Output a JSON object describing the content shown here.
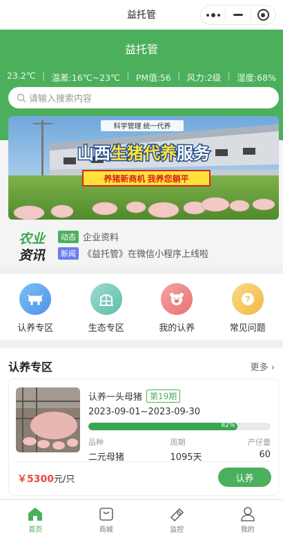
{
  "nav": {
    "title": "益托管"
  },
  "header": {
    "app_title": "益托管"
  },
  "weather": {
    "temperature": "23.2℃",
    "temp_range": "温差:16℃~23℃",
    "pm": "PM值:56",
    "wind": "风力:2级",
    "humidity": "湿度:68%"
  },
  "search": {
    "placeholder": "请输入搜索内容"
  },
  "banner": {
    "top_caption": "科学管理 统一代养",
    "headline_a": "山西",
    "headline_b": "生猪代养",
    "headline_c": "服务",
    "slogan": "养猪新商机 我养您躺平"
  },
  "news": {
    "logo_line1": "农业",
    "logo_line2": "资讯",
    "items": [
      {
        "tag": "动态",
        "text": "企业资料"
      },
      {
        "tag": "新闻",
        "text": "《益托管》在微信小程序上线啦"
      }
    ]
  },
  "entries": [
    {
      "label": "认养专区",
      "icon": "cow-icon",
      "color": "#5aa7f0"
    },
    {
      "label": "生态专区",
      "icon": "greenhouse-icon",
      "color": "#6fc9b8"
    },
    {
      "label": "我的认养",
      "icon": "pig-icon",
      "color": "#ef8a8a"
    },
    {
      "label": "常见问题",
      "icon": "question-icon",
      "color": "#f5c25a"
    }
  ],
  "section": {
    "title": "认养专区",
    "more": "更多"
  },
  "product": {
    "name": "认养一头母猪",
    "period": "第19期",
    "dates": "2023-09-01~2023-09-30",
    "progress_percent": 82,
    "progress_label": "82%",
    "attrs": [
      {
        "key": "品种",
        "value": "二元母猪"
      },
      {
        "key": "周期",
        "value": "1095天"
      },
      {
        "key": "产仔量",
        "value": "60"
      }
    ],
    "price": "￥5300",
    "unit": "元/只",
    "buy_label": "认养"
  },
  "tabbar": {
    "items": [
      {
        "label": "首页",
        "icon": "home-icon"
      },
      {
        "label": "商城",
        "icon": "shop-icon"
      },
      {
        "label": "监控",
        "icon": "monitor-icon"
      },
      {
        "label": "我的",
        "icon": "user-icon"
      }
    ]
  },
  "colors": {
    "brand_green": "#4caf5c",
    "price_red": "#e94a3b"
  }
}
